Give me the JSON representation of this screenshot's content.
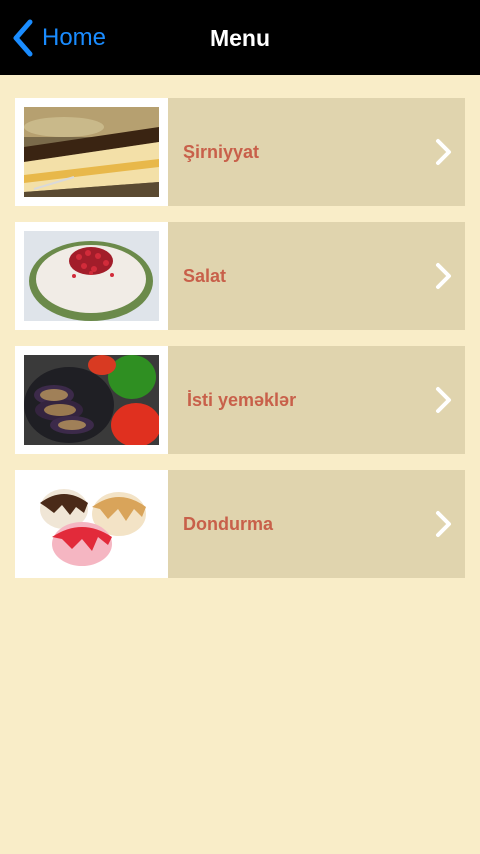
{
  "navbar": {
    "back_label": "Home",
    "title": "Menu",
    "back_icon": "chevron-left-icon",
    "accent_color": "#1a8cff"
  },
  "menu": {
    "items": [
      {
        "label": "Şirniyyat",
        "image": "cake-slice-photo"
      },
      {
        "label": "Salat",
        "image": "pomegranate-salad-photo"
      },
      {
        "label": "İsti yeməklər",
        "image": "stuffed-eggplant-photo"
      },
      {
        "label": "Dondurma",
        "image": "ice-cream-scoops-photo"
      }
    ],
    "item_icon": "chevron-right-icon"
  },
  "colors": {
    "background": "#f9edc8",
    "item_background": "#e0d4ae",
    "label_color": "#c8604a",
    "navbar": "#000000"
  }
}
